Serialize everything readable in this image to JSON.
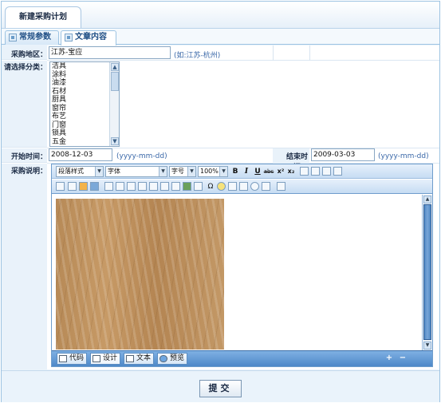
{
  "title": "新建采购计划",
  "tabs": [
    {
      "label": "常规参数",
      "active": false
    },
    {
      "label": "文章内容",
      "active": true
    }
  ],
  "form": {
    "region_label": "采购地区：",
    "region_value": "江苏-宝应",
    "region_hint": "(如:江苏-杭州)",
    "category_label": "请选择分类：",
    "categories": [
      "洁具",
      "涂料",
      "油漆",
      "石材",
      "厨具",
      "窗帘",
      "布艺",
      "门窗",
      "锁具",
      "五金"
    ],
    "start_label": "开始时间：",
    "start_value": "2008-12-03",
    "start_hint": "(yyyy-mm-dd)",
    "end_label": "结束时间：",
    "end_value": "2009-03-03",
    "end_hint": "(yyyy-mm-dd)",
    "desc_label": "采购说明："
  },
  "editor": {
    "paragraph_style": "段落样式",
    "font": "字体",
    "font_size": "字号",
    "zoom": "100%",
    "bold": "B",
    "italic": "I",
    "underline": "U",
    "strike": "abc",
    "superscript": "x²",
    "subscript": "x₂",
    "omega": "Ω",
    "modes": [
      {
        "label": "代码",
        "icon": "code-icon"
      },
      {
        "label": "设计",
        "icon": "design-icon"
      },
      {
        "label": "文本",
        "icon": "text-icon"
      },
      {
        "label": "预览",
        "icon": "preview-icon"
      }
    ],
    "expand_symbol": "+",
    "shrink_symbol": "−"
  },
  "submit_label": "提交",
  "colors": {
    "accent": "#4d88c8",
    "border": "#9dc3e2",
    "panel": "#eaf3fb"
  }
}
